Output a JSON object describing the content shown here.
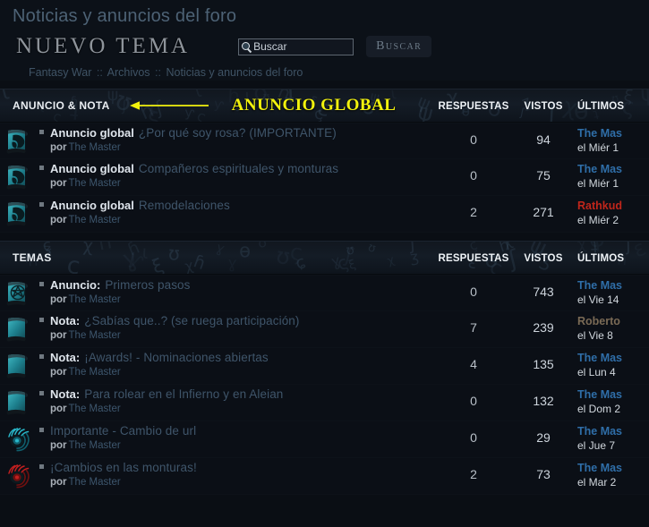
{
  "header": {
    "page_title": "Noticias y anuncios del foro",
    "new_topic_label": "NUEVO TEMA",
    "search": {
      "value": "Buscar",
      "placeholder": "Buscar",
      "button_label": "Buscar",
      "icon": "search-icon"
    },
    "breadcrumb": {
      "items": [
        "Fantasy War",
        "Archivos",
        "Noticias y anuncios del foro"
      ],
      "separator": "::"
    }
  },
  "annotation": {
    "text": "ANUNCIO GLOBAL",
    "color": "#f2f20d",
    "arrow_direction": "left"
  },
  "columns": {
    "replies": "RESPUESTAS",
    "views": "VISTOS",
    "last_post": "ÚLTIMOS"
  },
  "sections": [
    {
      "label": "ANUNCIO & NOTA",
      "has_annotation": true,
      "rows": [
        {
          "icon": "globe-scroll-icon",
          "prefix": "Anuncio global",
          "title": "¿Por qué soy rosa? (IMPORTANTE)",
          "by_label": "por",
          "author": "The Master",
          "replies": "0",
          "views": "94",
          "last_user": "The Mas",
          "last_user_color": "blue",
          "last_date": "el Miér 1"
        },
        {
          "icon": "globe-scroll-icon",
          "prefix": "Anuncio global",
          "title": "Compañeros espirituales y monturas",
          "by_label": "por",
          "author": "The Master",
          "replies": "0",
          "views": "75",
          "last_user": "The Mas",
          "last_user_color": "blue",
          "last_date": "el Miér 1"
        },
        {
          "icon": "globe-scroll-icon",
          "prefix": "Anuncio global",
          "title": "Remodelaciones",
          "by_label": "por",
          "author": "The Master",
          "replies": "2",
          "views": "271",
          "last_user": "Rathkud",
          "last_user_color": "red",
          "last_date": "el Miér 2"
        }
      ]
    },
    {
      "label": "TEMAS",
      "has_annotation": false,
      "rows": [
        {
          "icon": "pentagram-scroll-icon",
          "prefix": "Anuncio:",
          "title": "Primeros pasos",
          "by_label": "por",
          "author": "The Master",
          "replies": "0",
          "views": "743",
          "last_user": "The Mas",
          "last_user_color": "blue",
          "last_date": "el Vie 14"
        },
        {
          "icon": "scroll-icon",
          "prefix": "Nota:",
          "title": "¿Sabías que..? (se ruega participación)",
          "by_label": "por",
          "author": "The Master",
          "replies": "7",
          "views": "239",
          "last_user": "Roberto",
          "last_user_color": "tan",
          "last_date": "el Vie 8 "
        },
        {
          "icon": "scroll-icon",
          "prefix": "Nota:",
          "title": "¡Awards! - Nominaciones abiertas",
          "by_label": "por",
          "author": "The Master",
          "replies": "4",
          "views": "135",
          "last_user": "The Mas",
          "last_user_color": "blue",
          "last_date": "el Lun 4"
        },
        {
          "icon": "scroll-icon",
          "prefix": "Nota:",
          "title": "Para rolear en el Infierno y en Aleian",
          "by_label": "por",
          "author": "The Master",
          "replies": "0",
          "views": "132",
          "last_user": "The Mas",
          "last_user_color": "blue",
          "last_date": "el Dom 2"
        },
        {
          "icon": "eye-teal-icon",
          "prefix": "",
          "title": "Importante - Cambio de url",
          "by_label": "por",
          "author": "The Master",
          "replies": "0",
          "views": "29",
          "last_user": "The Mas",
          "last_user_color": "blue",
          "last_date": "el Jue 7"
        },
        {
          "icon": "eye-red-icon",
          "prefix": "",
          "title": "¡Cambios en las monturas!",
          "by_label": "por",
          "author": "The Master",
          "replies": "2",
          "views": "73",
          "last_user": "The Mas",
          "last_user_color": "blue",
          "last_date": "el Mar 2"
        }
      ]
    }
  ]
}
